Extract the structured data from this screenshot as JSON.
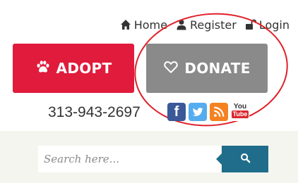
{
  "topnav": {
    "items": [
      {
        "label": "Home",
        "icon": "home-icon"
      },
      {
        "label": "Register",
        "icon": "user-icon"
      },
      {
        "label": "Login",
        "icon": "unlock-icon"
      }
    ]
  },
  "buttons": {
    "adopt": {
      "label": "ADOPT",
      "icon": "paw-icon",
      "color": "#e01b3c"
    },
    "donate": {
      "label": "DONATE",
      "icon": "heart-outline-icon",
      "color": "#8a8a8a"
    }
  },
  "contact": {
    "phone": "313-943-2697"
  },
  "social": {
    "facebook": {
      "glyph": "f",
      "color": "#3b5998"
    },
    "youtube": {
      "top": "You",
      "bottom": "Tube"
    }
  },
  "search": {
    "placeholder": "Search here...",
    "button_color": "#1f6d8a"
  }
}
